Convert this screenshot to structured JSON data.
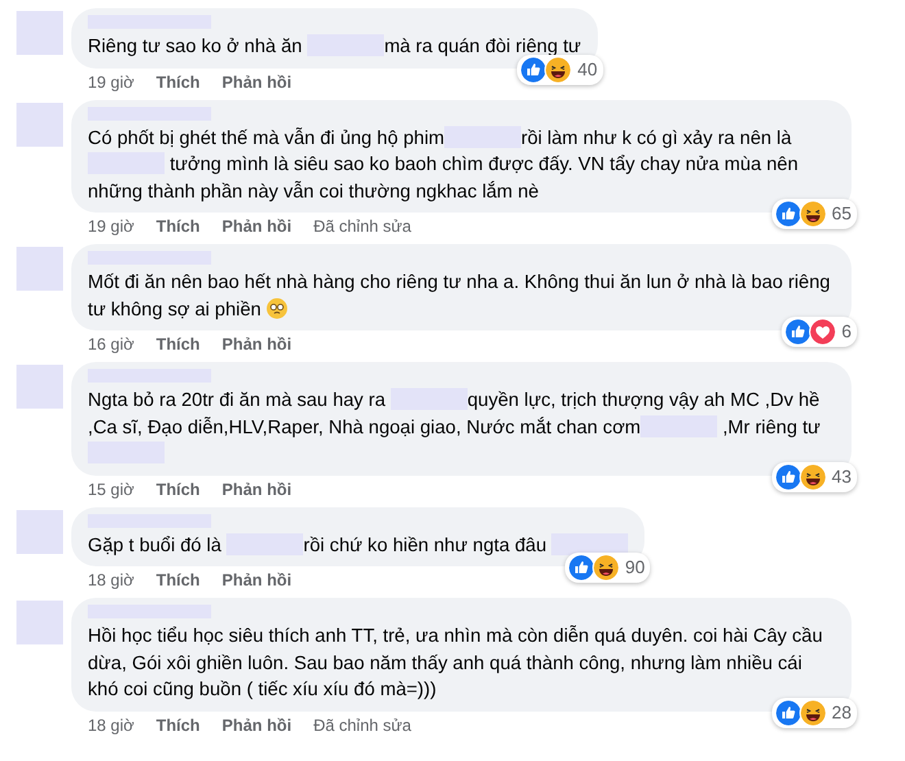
{
  "comments": [
    {
      "segments": [
        {
          "kind": "text",
          "text": "Riêng tư sao ko ở nhà ăn "
        },
        {
          "kind": "redacted"
        },
        {
          "kind": "text",
          "text": "mà ra quán đòi riêng tư"
        }
      ],
      "reactions": [
        {
          "kind": "like"
        },
        {
          "kind": "haha"
        }
      ],
      "reaction_count": "40",
      "time": "19 giờ",
      "like_label": "Thích",
      "reply_label": "Phản hồi"
    },
    {
      "segments": [
        {
          "kind": "text",
          "text": "Có phốt bị ghét thế mà vẫn đi ủng hộ phim"
        },
        {
          "kind": "redacted"
        },
        {
          "kind": "text",
          "text": "rồi làm như k có gì xảy ra nên là "
        },
        {
          "kind": "redacted"
        },
        {
          "kind": "text",
          "text": " tưởng mình là siêu sao ko baoh chìm được đấy. VN tẩy chay nửa mùa nên những thành phần này vẫn coi thường ngkhac lắm nè"
        }
      ],
      "reactions": [
        {
          "kind": "like"
        },
        {
          "kind": "haha"
        }
      ],
      "reaction_count": "65",
      "time": "19 giờ",
      "like_label": "Thích",
      "reply_label": "Phản hồi",
      "edited_label": "Đã chỉnh sửa"
    },
    {
      "segments": [
        {
          "kind": "text",
          "text": "Mốt đi ăn nên bao hết nhà hàng cho riêng tư nha a. Không thui ăn lun ở nhà là bao riêng tư không sợ ai phiền "
        },
        {
          "kind": "emoji"
        }
      ],
      "reactions": [
        {
          "kind": "like"
        },
        {
          "kind": "love"
        }
      ],
      "reaction_count": "6",
      "time": "16 giờ",
      "like_label": "Thích",
      "reply_label": "Phản hồi"
    },
    {
      "segments": [
        {
          "kind": "text",
          "text": "Ngta bỏ ra 20tr đi ăn mà sau hay ra "
        },
        {
          "kind": "redacted"
        },
        {
          "kind": "text",
          "text": "quyền lực, trịch thượng vậy ah MC ,Dv hề ,Ca sĩ, Đạo diễn,HLV,Raper, Nhà ngoại giao, Nước mắt chan cơm"
        },
        {
          "kind": "redacted"
        },
        {
          "kind": "text",
          "text": " ,Mr riêng tư "
        },
        {
          "kind": "redacted"
        }
      ],
      "reactions": [
        {
          "kind": "like"
        },
        {
          "kind": "haha"
        }
      ],
      "reaction_count": "43",
      "time": "15 giờ",
      "like_label": "Thích",
      "reply_label": "Phản hồi"
    },
    {
      "segments": [
        {
          "kind": "text",
          "text": "Gặp t buổi đó là "
        },
        {
          "kind": "redacted"
        },
        {
          "kind": "text",
          "text": "rồi chứ ko hiền như ngta đâu "
        },
        {
          "kind": "redacted"
        }
      ],
      "reactions": [
        {
          "kind": "like"
        },
        {
          "kind": "haha"
        }
      ],
      "reaction_count": "90",
      "time": "18 giờ",
      "like_label": "Thích",
      "reply_label": "Phản hồi"
    },
    {
      "segments": [
        {
          "kind": "text",
          "text": "Hồi học tiểu học siêu thích anh TT, trẻ, ưa nhìn mà còn diễn quá duyên. coi hài Cây cầu dừa, Gói xôi ghiền luôn. Sau bao năm thấy anh quá thành công, nhưng làm nhiều cái khó coi cũng buồn ( tiếc xíu xíu đó mà=)))"
        }
      ],
      "reactions": [
        {
          "kind": "like"
        },
        {
          "kind": "haha"
        }
      ],
      "reaction_count": "28",
      "time": "18 giờ",
      "like_label": "Thích",
      "reply_label": "Phản hồi",
      "edited_label": "Đã chỉnh sửa"
    }
  ]
}
